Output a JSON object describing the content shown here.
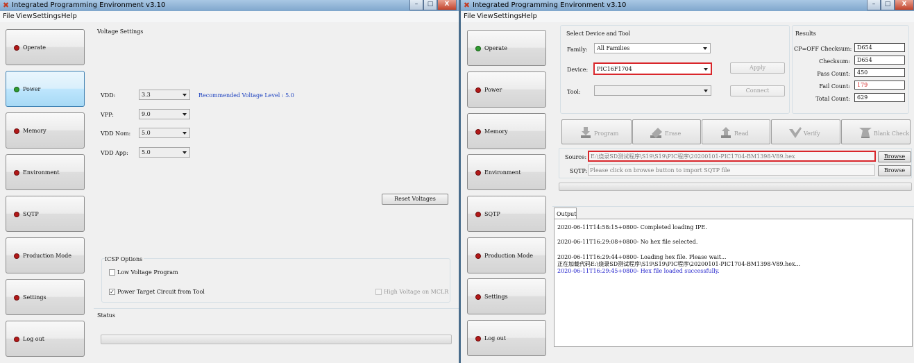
{
  "left_window": {
    "title": "Integrated Programming Environment v3.10",
    "caption_buttons": [
      "–",
      "□",
      "X"
    ],
    "menu": [
      "File",
      "View",
      "Settings",
      "Help"
    ],
    "nav": [
      "Operate",
      "Power",
      "Memory",
      "Environment",
      "SQTP",
      "Production Mode",
      "Settings",
      "Log out"
    ],
    "voltage": {
      "heading": "Voltage Settings",
      "rows": [
        {
          "label": "VDD:",
          "value": "3.3"
        },
        {
          "label": "VPP:",
          "value": "9.0"
        },
        {
          "label": "VDD Nom:",
          "value": "5.0"
        },
        {
          "label": "VDD App:",
          "value": "5.0"
        }
      ],
      "recommended": "Recommended Voltage Level : 5.0",
      "reset_label": "Reset Voltages"
    },
    "icsp": {
      "heading": "ICSP Options",
      "low_voltage": "Low Voltage Program",
      "power_target": "Power Target Circuit from Tool",
      "high_voltage": "High Voltage on MCLR"
    },
    "status_heading": "Status"
  },
  "right_window": {
    "title": "Integrated Programming Environment v3.10",
    "menu": [
      "File",
      "View",
      "Settings",
      "Help"
    ],
    "nav": [
      "Operate",
      "Power",
      "Memory",
      "Environment",
      "SQTP",
      "Production Mode",
      "Settings",
      "Log out"
    ],
    "device_section": {
      "heading": "Select Device and Tool",
      "family_label": "Family:",
      "family_value": "All Families",
      "device_label": "Device:",
      "device_value": "PIC16F1704",
      "tool_label": "Tool:",
      "tool_value": "",
      "apply_label": "Apply",
      "connect_label": "Connect"
    },
    "results": {
      "heading": "Results",
      "rows": [
        {
          "label": "CP=OFF Checksum:",
          "value": "D654"
        },
        {
          "label": "Checksum:",
          "value": "D654"
        },
        {
          "label": "Pass Count:",
          "value": "450"
        },
        {
          "label": "Fail Count:",
          "value": "179"
        },
        {
          "label": "Total Count:",
          "value": "629"
        }
      ]
    },
    "operations": [
      "Program",
      "Erase",
      "Read",
      "Verify",
      "Blank Check"
    ],
    "source": {
      "label": "Source:",
      "value": "E:\\烧录SD测试程序\\S19\\S19\\PIC程序\\20200101-PIC1704-BM1398-V89.hex",
      "browse_label": "Browse"
    },
    "sqtp": {
      "label": "SQTP:",
      "placeholder": "Please click on browse button to import SQTP file",
      "browse_label": "Browse"
    },
    "output": {
      "tab": "Output",
      "lines": [
        "2020-06-11T14:58:15+0800- Completed loading IPE.",
        "2020-06-11T16:29:08+0800- No hex file selected.",
        "2020-06-11T16:29:44+0800- Loading hex file. Please wait...",
        "正在加载代码E:\\烧录SD测试程序\\S19\\S19\\PIC程序\\20200101-PIC1704-BM1398-V89.hex...",
        "2020-06-11T16:29:45+0800- Hex file loaded successfully."
      ]
    }
  },
  "colors": {
    "title_gradient_top": "#a9c7e4",
    "status_led_red": "#b21818",
    "status_led_green": "#2f9a2f",
    "highlight_red": "#d9262b",
    "recommended_text": "#1a3fbf",
    "success_log": "#2222cc",
    "fail_count": "#d02020"
  },
  "icons": {
    "app": "app-logo-icon",
    "status_led": "status-led-icon",
    "program": "program-arrow-icon",
    "erase": "erase-icon",
    "read": "read-arrow-icon",
    "verify": "verify-check-icon",
    "blank_check": "blank-check-icon"
  }
}
